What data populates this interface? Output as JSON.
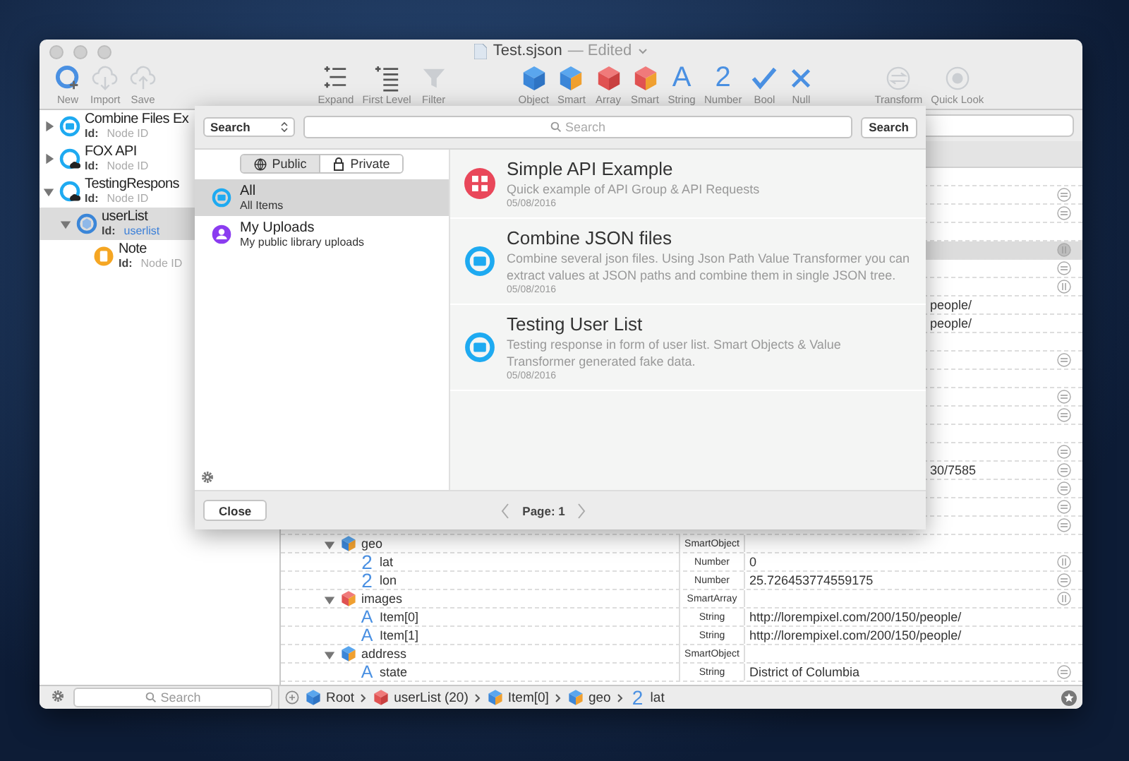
{
  "window": {
    "title": "Test.sjson",
    "status": "— Edited"
  },
  "toolbar": [
    {
      "label": "New",
      "kind": "new",
      "disabled": false
    },
    {
      "label": "Import",
      "kind": "import",
      "disabled": true
    },
    {
      "label": "Save",
      "kind": "save",
      "disabled": true
    },
    {
      "label": "Expand",
      "kind": "expand",
      "disabled": false
    },
    {
      "label": "First Level",
      "kind": "firstlevel",
      "disabled": false
    },
    {
      "label": "Filter",
      "kind": "filter",
      "disabled": true
    },
    {
      "label": "Object",
      "kind": "object",
      "disabled": false
    },
    {
      "label": "Smart",
      "kind": "smartobject",
      "disabled": false
    },
    {
      "label": "Array",
      "kind": "array",
      "disabled": false
    },
    {
      "label": "Smart",
      "kind": "smartarray",
      "disabled": false
    },
    {
      "label": "String",
      "kind": "string",
      "glyph": "A",
      "disabled": false
    },
    {
      "label": "Number",
      "kind": "number",
      "glyph": "2",
      "disabled": false
    },
    {
      "label": "Bool",
      "kind": "bool",
      "disabled": false
    },
    {
      "label": "Null",
      "kind": "null",
      "disabled": false
    },
    {
      "label": "Transform",
      "kind": "transform",
      "disabled": true
    },
    {
      "label": "Quick Look",
      "kind": "quicklook",
      "disabled": true
    }
  ],
  "sidebar": {
    "nodes": [
      {
        "name": "Combine Files Ex",
        "id_label": "Id:",
        "id": "Node ID",
        "kind": "folder",
        "expanded": false,
        "selected": false
      },
      {
        "name": "FOX API",
        "id_label": "Id:",
        "id": "Node ID",
        "kind": "api",
        "expanded": false,
        "selected": false
      },
      {
        "name": "TestingRespons",
        "id_label": "Id:",
        "id": "Node ID",
        "kind": "api",
        "expanded": true,
        "selected": false,
        "children": [
          {
            "name": "userList",
            "id_label": "Id:",
            "id": "userlist",
            "kind": "object",
            "expanded": true,
            "selected": true,
            "children": [
              {
                "name": "Note",
                "id_label": "Id:",
                "id": "Node ID",
                "kind": "note",
                "selected": false
              }
            ]
          }
        ]
      }
    ],
    "search": {
      "placeholder": "Search"
    }
  },
  "table": {
    "covered_rows": [
      {
        "selected": false
      },
      {
        "action": {
          "kind": "swap"
        },
        "selected": false
      },
      {
        "action": {
          "kind": "swap"
        },
        "selected": false
      },
      {
        "selected": false
      },
      {
        "action": {
          "kind": "sort"
        },
        "selected": true
      },
      {
        "action": {
          "kind": "swap"
        },
        "selected": false
      },
      {
        "action": {
          "kind": "sort"
        },
        "selected": false
      },
      {
        "value": "people/",
        "selected": false
      },
      {
        "value": "people/",
        "selected": false
      },
      {
        "selected": false
      },
      {
        "action": {
          "kind": "swap"
        },
        "selected": false
      },
      {
        "selected": false
      },
      {
        "action": {
          "kind": "swap"
        },
        "selected": false
      },
      {
        "action": {
          "kind": "swap"
        },
        "selected": false
      },
      {
        "selected": false
      },
      {
        "action": {
          "kind": "swap"
        },
        "selected": false
      },
      {
        "value": "30/7585",
        "action": {
          "kind": "swap"
        },
        "selected": false
      },
      {
        "action": {
          "kind": "swap"
        },
        "selected": false
      },
      {
        "action": {
          "kind": "swap"
        },
        "selected": false
      },
      {
        "action": {
          "kind": "swap"
        },
        "selected": false
      }
    ],
    "rows": [
      {
        "name": "geo",
        "kind": "smartobject",
        "type": "SmartObject",
        "expanded": true,
        "children": [
          {
            "name": "lat",
            "kind": "number",
            "glyph": "2",
            "type": "Number",
            "value": "0",
            "action": {
              "kind": "sort"
            }
          },
          {
            "name": "lon",
            "kind": "number",
            "glyph": "2",
            "type": "Number",
            "value": "25.726453774559175",
            "action": {
              "kind": "swap"
            }
          }
        ]
      },
      {
        "name": "images",
        "kind": "smartarray",
        "type": "SmartArray",
        "expanded": true,
        "action": {
          "kind": "sort"
        },
        "children": [
          {
            "name": "Item[0]",
            "kind": "string",
            "glyph": "A",
            "type": "String",
            "value": "http://lorempixel.com/200/150/people/"
          },
          {
            "name": "Item[1]",
            "kind": "string",
            "glyph": "A",
            "type": "String",
            "value": "http://lorempixel.com/200/150/people/"
          }
        ]
      },
      {
        "name": "address",
        "kind": "smartobject",
        "type": "SmartObject",
        "expanded": true,
        "children": [
          {
            "name": "state",
            "kind": "string",
            "glyph": "A",
            "type": "String",
            "value": "District of Columbia",
            "action": {
              "kind": "swap"
            }
          }
        ]
      }
    ]
  },
  "path_bar": [
    {
      "label": "Root",
      "kind": "object"
    },
    {
      "label": "userList (20)",
      "kind": "array"
    },
    {
      "label": "Item[0]",
      "kind": "smartobject"
    },
    {
      "label": "geo",
      "kind": "smartobject"
    },
    {
      "label": "lat",
      "kind": "number",
      "glyph": "2"
    }
  ],
  "library_sheet": {
    "scope_select": "Search",
    "search": {
      "placeholder": "Search"
    },
    "search_button": "Search",
    "segments": [
      {
        "label": "Public",
        "kind": "globe",
        "selected": true
      },
      {
        "label": "Private",
        "kind": "lock",
        "selected": false
      }
    ],
    "sources": [
      {
        "title": "All",
        "subtitle": "All Items",
        "kind": "folder",
        "selected": true
      },
      {
        "title": "My Uploads",
        "subtitle": "My public library uploads",
        "kind": "user",
        "selected": false
      }
    ],
    "items": [
      {
        "title": "Simple API Example",
        "description": "Quick example of API Group & API Requests",
        "date": "05/08/2016",
        "kind": "group"
      },
      {
        "title": "Combine JSON files",
        "description": "Combine several json files. Using Json Path Value Transformer you can extract values at JSON paths and combine them in single JSON tree.",
        "date": "05/08/2016",
        "kind": "folder"
      },
      {
        "title": "Testing User List",
        "description": "Testing response in form of user list. Smart Objects & Value Transformer generated fake data.",
        "date": "05/08/2016",
        "kind": "folder"
      }
    ],
    "close_button": "Close",
    "page_label": "Page: 1"
  }
}
